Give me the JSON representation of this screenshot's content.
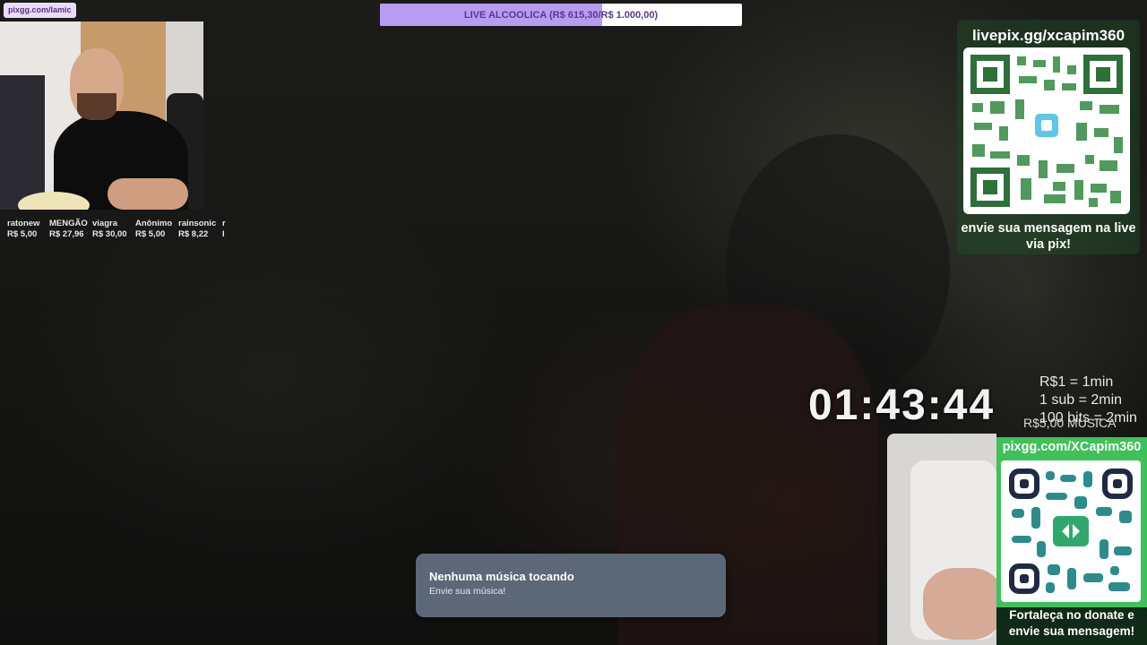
{
  "goal": {
    "label": "LIVE ALCOOLICA (R$ 615,30/R$ 1.000,00)",
    "progress_fraction": 0.615,
    "fill_color": "#b79cf2"
  },
  "webcam_top": {
    "source_tag": "pixgg.com/lamic"
  },
  "donors": [
    {
      "name": "ratonew",
      "amount": "R$ 5,00"
    },
    {
      "name": "MENGÃO",
      "amount": "R$ 27,96"
    },
    {
      "name": "viagra",
      "amount": "R$ 30,00"
    },
    {
      "name": "Anônimo",
      "amount": "R$ 5,00"
    },
    {
      "name": "rainsonic",
      "amount": "R$ 8,22"
    },
    {
      "name": "r",
      "amount": "I"
    }
  ],
  "qr_top": {
    "url": "livepix.gg/xcapim360",
    "caption": "envie sua mensagem na live via pix!",
    "icon": "livepix-logo-icon"
  },
  "timer": {
    "value": "01:43:44",
    "rates": [
      "R$1 = 1min",
      "1 sub = 2min",
      "100 bits = 2min"
    ],
    "music_price": "R$5,00 MUSICA"
  },
  "qr_bottom": {
    "url": "pixgg.com/XCapim360",
    "caption": "Fortaleça no donate e envie sua mensagem!",
    "icon": "pixgg-logo-icon",
    "accent": "#3fc15a"
  },
  "music_toast": {
    "title": "Nenhuma música tocando",
    "subtitle": "Envie sua música!"
  }
}
